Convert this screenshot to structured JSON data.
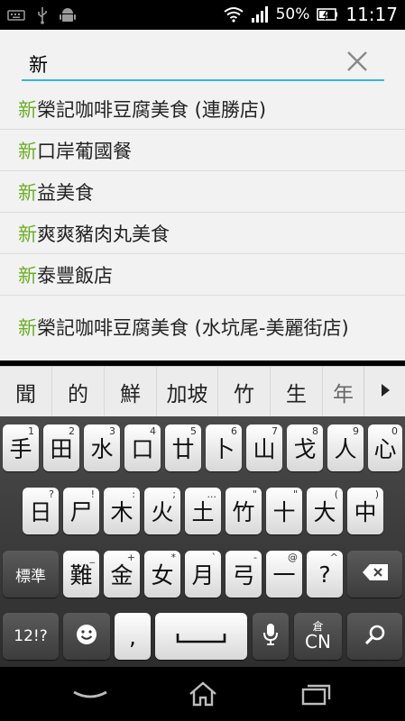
{
  "status_bar": {
    "battery_percent": "50%",
    "time": "11:17",
    "icons": [
      "keyboard-icon",
      "usb-icon",
      "android-icon",
      "wifi-icon",
      "signal-icon",
      "battery-charging-icon"
    ]
  },
  "search": {
    "value": "新",
    "clear_icon": "close-icon",
    "accent_color": "#33b5e5"
  },
  "suggestions": [
    {
      "prefix": "新",
      "rest": "榮記咖啡豆腐美食 (連勝店)"
    },
    {
      "prefix": "新",
      "rest": "口岸葡國餐"
    },
    {
      "prefix": "新",
      "rest": "益美食"
    },
    {
      "prefix": "新",
      "rest": "爽爽豬肉丸美食"
    },
    {
      "prefix": "新",
      "rest": "泰豐飯店"
    },
    {
      "prefix": "新",
      "rest": "榮記咖啡豆腐美食 (水坑尾-美麗街店)"
    }
  ],
  "highlight_color": "#6ab023",
  "candidates": [
    "聞",
    "的",
    "鮮",
    "加坡",
    "竹",
    "生",
    "年"
  ],
  "keyboard": {
    "row1": [
      {
        "main": "手",
        "sub": "1"
      },
      {
        "main": "田",
        "sub": "2"
      },
      {
        "main": "水",
        "sub": "3"
      },
      {
        "main": "口",
        "sub": "4"
      },
      {
        "main": "廿",
        "sub": "5"
      },
      {
        "main": "卜",
        "sub": "6"
      },
      {
        "main": "山",
        "sub": "7"
      },
      {
        "main": "戈",
        "sub": "8"
      },
      {
        "main": "人",
        "sub": "9"
      },
      {
        "main": "心",
        "sub": "0"
      }
    ],
    "row2": [
      {
        "main": "日",
        "sub": "?"
      },
      {
        "main": "尸",
        "sub": "!"
      },
      {
        "main": "木",
        "sub": ":"
      },
      {
        "main": "火",
        "sub": ";"
      },
      {
        "main": "土",
        "sub": "..."
      },
      {
        "main": "竹",
        "sub": "\""
      },
      {
        "main": "十",
        "sub": "\""
      },
      {
        "main": "大",
        "sub": "("
      },
      {
        "main": "中",
        "sub": ")"
      }
    ],
    "row3": [
      {
        "main": "難",
        "sub": "_"
      },
      {
        "main": "金",
        "sub": "+"
      },
      {
        "main": "女",
        "sub": "*"
      },
      {
        "main": "月",
        "sub": "`"
      },
      {
        "main": "弓",
        "sub": "-"
      },
      {
        "main": "一",
        "sub": "@"
      },
      {
        "main": "?",
        "sub": "^"
      }
    ],
    "mode_label": "標準",
    "symbols_label": "12!?",
    "comma_label": ",",
    "lang_label": "CN",
    "lang_sub": "倉"
  }
}
